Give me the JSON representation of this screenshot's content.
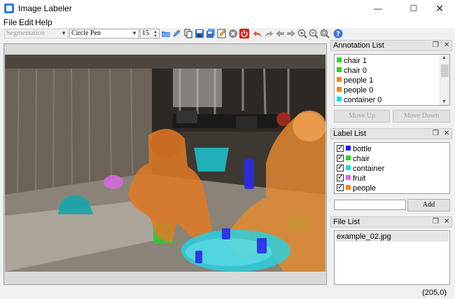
{
  "window": {
    "title": "Image Labeler"
  },
  "menu": {
    "file": "File",
    "edit": "Edit",
    "help": "Help"
  },
  "toolbar": {
    "mode_select": "Segmentation",
    "pen_select": "Circle Pen",
    "pen_size": "15"
  },
  "annotation_list": {
    "title": "Annotation List",
    "items": [
      {
        "label": "chair 1",
        "color": "#33cc33"
      },
      {
        "label": "chair 0",
        "color": "#33cc33"
      },
      {
        "label": "people 1",
        "color": "#f08a24"
      },
      {
        "label": "people 0",
        "color": "#f08a24"
      },
      {
        "label": "container 0",
        "color": "#22d3e6"
      }
    ],
    "move_up": "Move Up",
    "move_down": "Move Down"
  },
  "label_list": {
    "title": "Label List",
    "items": [
      {
        "label": "bottle",
        "color": "#1a1aff",
        "checked": true
      },
      {
        "label": "chair",
        "color": "#33cc33",
        "checked": true
      },
      {
        "label": "container",
        "color": "#22d3e6",
        "checked": true
      },
      {
        "label": "fruit",
        "color": "#e066e6",
        "checked": true
      },
      {
        "label": "people",
        "color": "#f08a24",
        "checked": true
      }
    ],
    "add_input_value": "",
    "add_button": "Add"
  },
  "file_list": {
    "title": "File List",
    "items": [
      "example_02.jpg"
    ]
  },
  "status": {
    "coords": "(205,0)"
  }
}
